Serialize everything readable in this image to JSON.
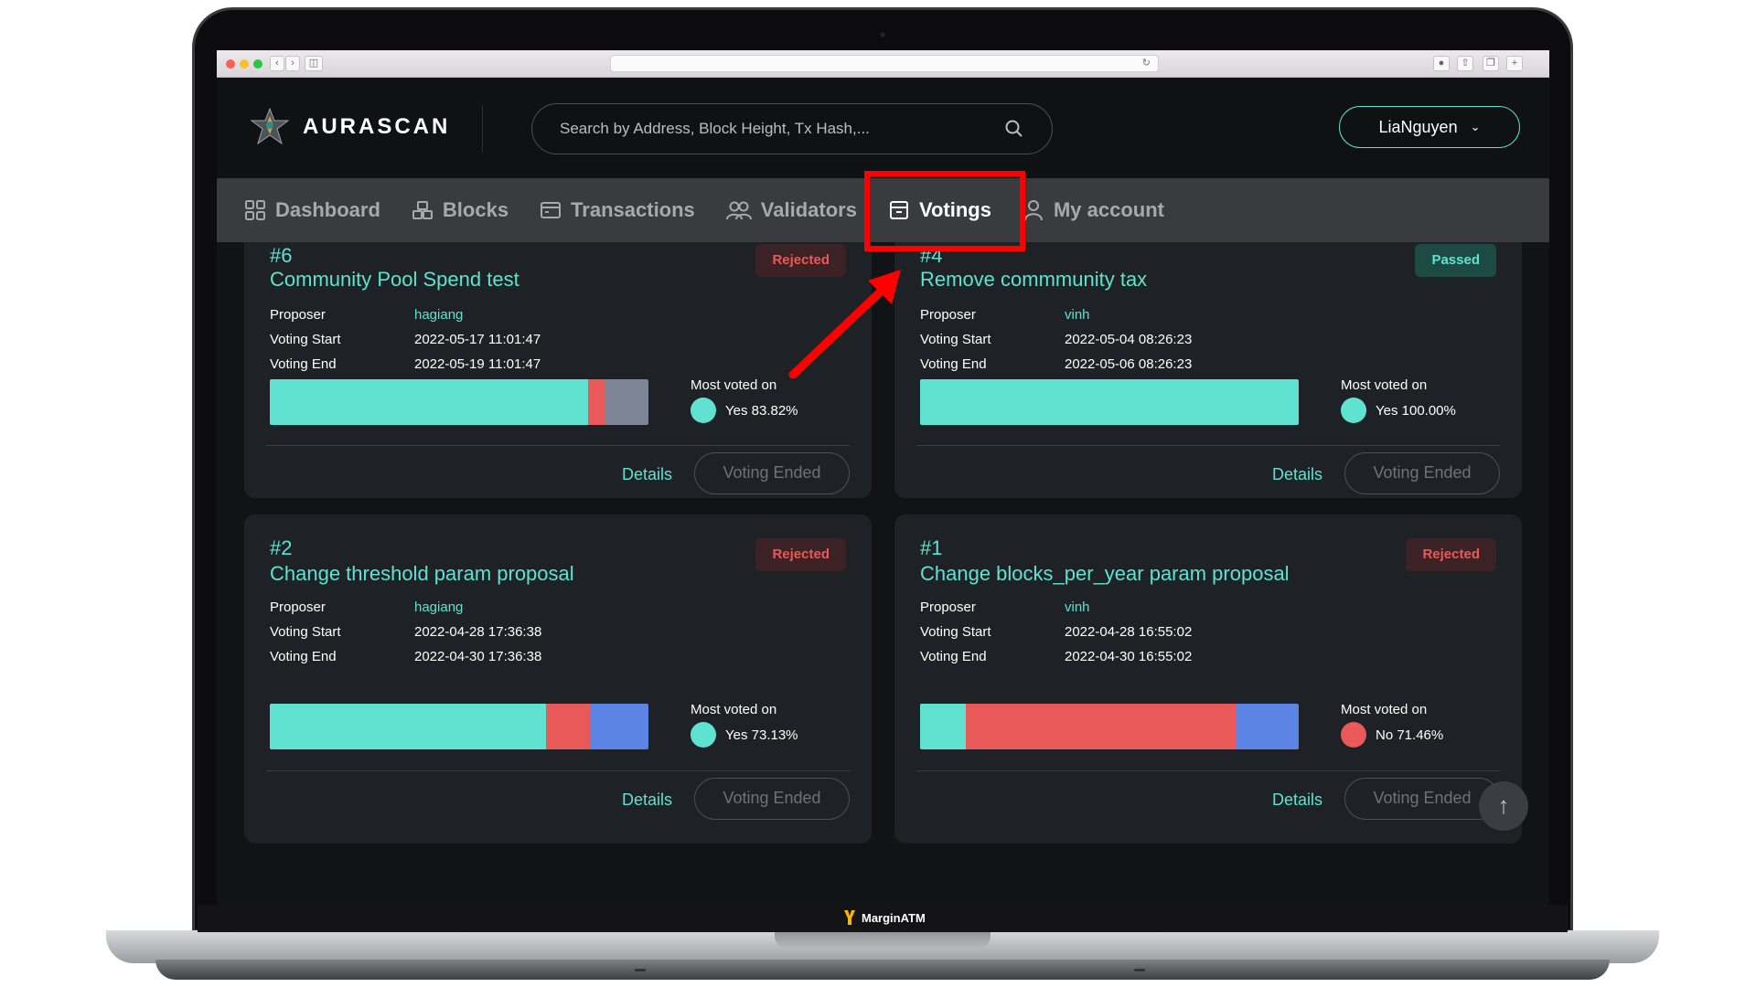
{
  "browser": {
    "url": ""
  },
  "brand": {
    "name": "AURASCAN",
    "accent": "#5fe3d0"
  },
  "search": {
    "placeholder": "Search by Address, Block Height, Tx Hash,..."
  },
  "user": {
    "name": "LiaNguyen"
  },
  "nav": {
    "items": [
      {
        "label": "Dashboard",
        "icon": "dashboard-icon"
      },
      {
        "label": "Blocks",
        "icon": "blocks-icon"
      },
      {
        "label": "Transactions",
        "icon": "transactions-icon"
      },
      {
        "label": "Validators",
        "icon": "validators-icon"
      },
      {
        "label": "Votings",
        "icon": "votings-icon",
        "active": true
      },
      {
        "label": "My account",
        "icon": "user-icon"
      }
    ]
  },
  "labels": {
    "proposer": "Proposer",
    "voting_start": "Voting Start",
    "voting_end": "Voting End",
    "most_voted_on": "Most voted on",
    "details": "Details",
    "voting_ended": "Voting Ended"
  },
  "proposals": [
    {
      "id": "#6",
      "title": "Community Pool Spend test",
      "status": "Rejected",
      "proposer": "hagiang",
      "voting_start": "2022-05-17 11:01:47",
      "voting_end": "2022-05-19 11:01:47",
      "most_voted": "Yes 83.82%",
      "most_voted_color": "#5fe3d0",
      "bar": [
        {
          "color": "#5fe3d0",
          "share": 0.84
        },
        {
          "color": "#e85a5a",
          "share": 0.045
        },
        {
          "color": "#7d8596",
          "share": 0.115
        }
      ]
    },
    {
      "id": "#4",
      "title": "Remove commmunity tax",
      "status": "Passed",
      "proposer": "vinh",
      "voting_start": "2022-05-04 08:26:23",
      "voting_end": "2022-05-06 08:26:23",
      "most_voted": "Yes 100.00%",
      "most_voted_color": "#5fe3d0",
      "bar": [
        {
          "color": "#5fe3d0",
          "share": 1.0
        }
      ]
    },
    {
      "id": "#2",
      "title": "Change threshold param proposal",
      "status": "Rejected",
      "proposer": "hagiang",
      "voting_start": "2022-04-28 17:36:38",
      "voting_end": "2022-04-30 17:36:38",
      "most_voted": "Yes 73.13%",
      "most_voted_color": "#5fe3d0",
      "bar": [
        {
          "color": "#5fe3d0",
          "share": 0.73
        },
        {
          "color": "#e85a5a",
          "share": 0.115
        },
        {
          "color": "#5b84e5",
          "share": 0.155
        }
      ]
    },
    {
      "id": "#1",
      "title": "Change blocks_per_year param proposal",
      "status": "Rejected",
      "proposer": "vinh",
      "voting_start": "2022-04-28 16:55:02",
      "voting_end": "2022-04-30 16:55:02",
      "most_voted": "No 71.46%",
      "most_voted_color": "#e85a5a",
      "bar": [
        {
          "color": "#5fe3d0",
          "share": 0.12
        },
        {
          "color": "#e85a5a",
          "share": 0.715
        },
        {
          "color": "#5b84e5",
          "share": 0.165
        }
      ]
    }
  ],
  "footer": {
    "watermark": "MarginATM"
  }
}
